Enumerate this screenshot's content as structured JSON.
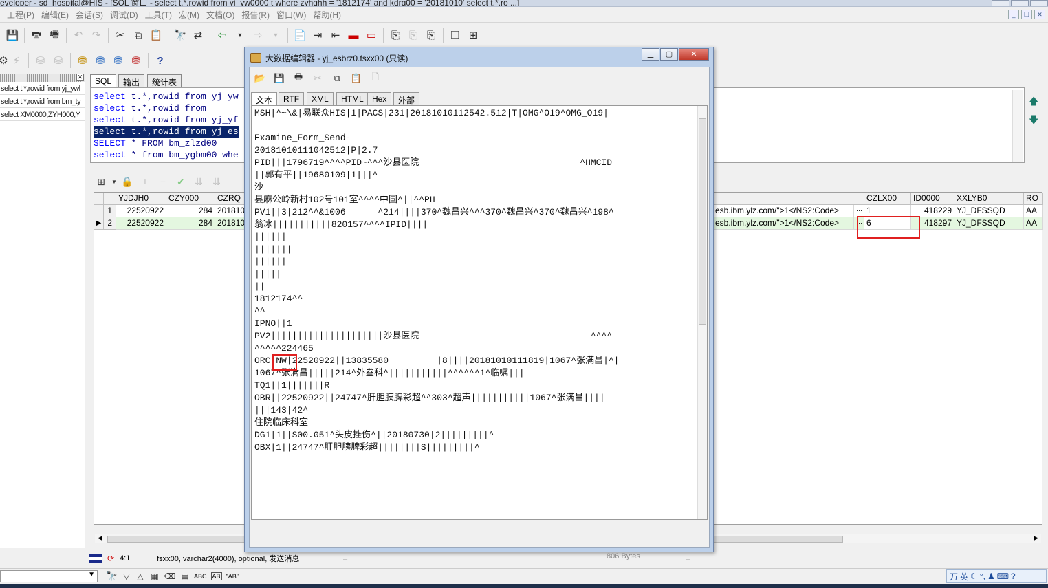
{
  "window": {
    "title": "eveloper - sd_hospital@HIS - [SQL 窗口 - select t.*,rowid from yj_yw0000 t where zyhghh = '1812174' and kdrq00 = '20181010' select t.*,ro ...]"
  },
  "menu": [
    "工程(P)",
    "编辑(E)",
    "会话(S)",
    "调试(D)",
    "工具(T)",
    "宏(M)",
    "文档(O)",
    "报告(R)",
    "窗口(W)",
    "帮助(H)"
  ],
  "history": [
    "select t.*,rowid from yj_ywl",
    "select t.*,rowid from bm_ty",
    "select XM0000,ZYH000,Y"
  ],
  "sql_tabs": [
    "SQL",
    "输出",
    "统计表"
  ],
  "sql_lines": [
    {
      "kw": "select",
      "rest": "t.*,rowid from yj_yw"
    },
    {
      "kw": "select",
      "rest": "t.*,rowid from"
    },
    {
      "kw": "select",
      "rest": "t.*,rowid from yj_yf"
    },
    {
      "kw": "select",
      "rest": "t.*,rowid from yj_es"
    },
    {
      "kw": "SELECT",
      "rest": "* FROM bm_zlzd00"
    },
    {
      "kw": "select",
      "rest": "* from bm_ygbm00 whe"
    }
  ],
  "grid": {
    "left_columns": [
      "YJDJH0",
      "CZY000",
      "CZRQ"
    ],
    "right_columns": [
      "CZLX00",
      "ID0000",
      "XXLYB0",
      "RO"
    ],
    "rows": [
      {
        "num": "1",
        "yjdjh0": "22520922",
        "czy000": "284",
        "czrq": "201810",
        "xml": "esb.ibm.ylz.com/\">1</NS2:Code>",
        "ellipsis": "···",
        "czlx00": "1",
        "id0000": "418229",
        "xxlyb0": "YJ_DFSSQD",
        "ro": "AA"
      },
      {
        "num": "2",
        "yjdjh0": "22520922",
        "czy000": "284",
        "czrq": "201810",
        "xml": "esb.ibm.ylz.com/\">1</NS2:Code>",
        "ellipsis": "···",
        "czlx00": "6",
        "id0000": "418297",
        "xxlyb0": "YJ_DFSSQD",
        "ro": "AA"
      }
    ]
  },
  "status": {
    "position": "4:1",
    "field_info": "fsxx00, varchar2(4000), optional, 发送消息"
  },
  "bottom": {
    "find_labels": [
      "ABC",
      "AB",
      "\"AB\""
    ]
  },
  "ime": {
    "label": "英"
  },
  "dialog": {
    "title": "大数据编辑器 - yj_esbrz0.fsxx00 (只读)",
    "tabs": [
      "文本",
      "RTF",
      "XML",
      "HTML",
      "Hex",
      "外部"
    ],
    "lines": [
      "MSH|^~\\&|易联众HIS|1|PACS|231|20181010112542.512|T|OMG^O19^OMG_O19|",
      "",
      "Examine_Form_Send-",
      "20181010111042512|P|2.7",
      "PID|||1796719^^^^PID~^^^沙县医院                              ^HMCID",
      "||郭有平||19680109|1|||^",
      "沙",
      "县麻公岭新村102号101室^^^^中国^||^^PH",
      "PV1||3|212^^&1006      ^214||||370^魏昌兴^^^370^魏昌兴^370^魏昌兴^198^",
      "翁冰|||||||||||820157^^^^IPID||||",
      "||||||",
      "|||||||",
      "||||||",
      "|||||",
      "||",
      "1812174^^",
      "^^",
      "IPNO||1",
      "PV2|||||||||||||||||||||沙县医院                                ^^^^",
      "^^^^^224465",
      "ORC|NW|22520922||13835580         |8||||20181010111819|1067^张满昌|^|",
      "1067^张满昌|||||214^外叁科^|||||||||||^^^^^^1^临嘱|||",
      "TQ1||1|||||||R",
      "OBR||22520922||24747^肝胆胰脾彩超^^303^超声|||||||||||1067^张满昌||||",
      "|||143|42^",
      "住院临床科室",
      "DG1|1||S00.051^头皮挫伤^||20180730|2|||||||||^",
      "OBX|1||24747^肝胆胰脾彩超||||||||S|||||||||^"
    ],
    "size_label": "806 Bytes",
    "dashes": [
      "–",
      "–",
      "–"
    ]
  }
}
